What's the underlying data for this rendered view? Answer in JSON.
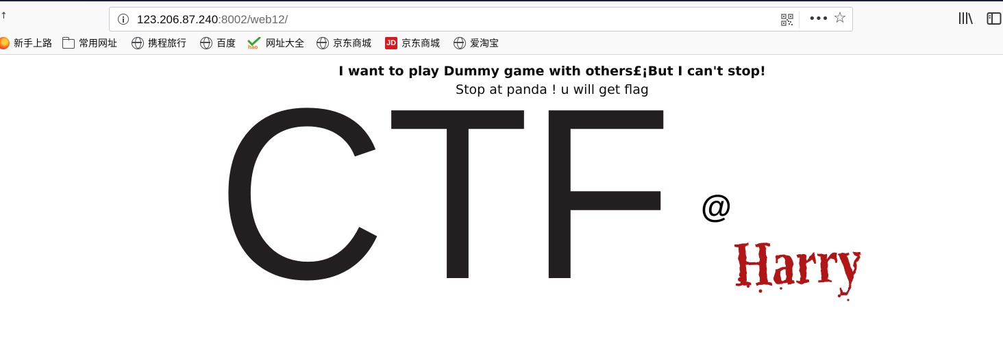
{
  "browser": {
    "url_host": "123.206.87.240",
    "url_path": ":8002/web12/"
  },
  "bookmarks": [
    {
      "label": "新手上路",
      "icon": "firefox-icon"
    },
    {
      "label": "常用网址",
      "icon": "folder-icon"
    },
    {
      "label": "携程旅行",
      "icon": "globe-icon"
    },
    {
      "label": "百度",
      "icon": "globe-icon"
    },
    {
      "label": "网址大全",
      "icon": "hao-icon"
    },
    {
      "label": "京东商城",
      "icon": "globe-icon"
    },
    {
      "label": "京东商城",
      "icon": "jd-icon"
    },
    {
      "label": "爱淘宝",
      "icon": "globe-icon"
    }
  ],
  "page": {
    "heading": "I want to play Dummy game with others£¡But I can't stop!",
    "subheading": "Stop at panda ! u will get flag",
    "logo": {
      "ctf": "CTF",
      "at": "@",
      "signature": "Harry"
    }
  },
  "colors": {
    "logo_text": "#231f20",
    "signature": "#b01217",
    "chrome_background": "#f9f9fa"
  }
}
